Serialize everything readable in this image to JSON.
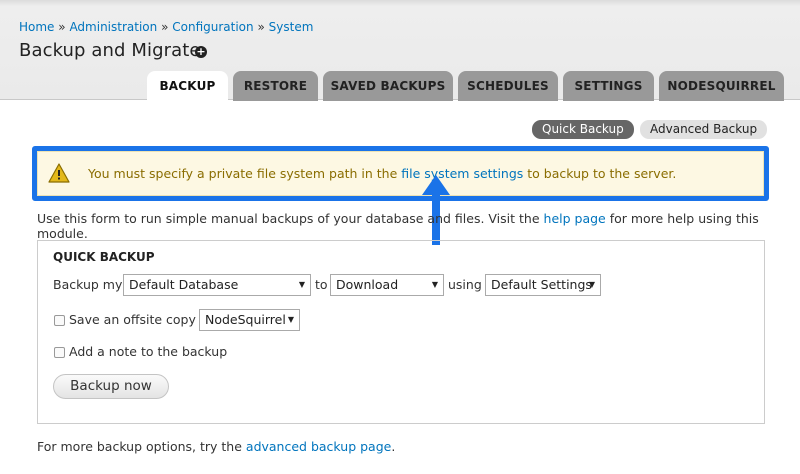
{
  "breadcrumb": {
    "items": [
      "Home",
      "Administration",
      "Configuration",
      "System"
    ],
    "separator": "»"
  },
  "page_title": "Backup and Migrate",
  "tabs": [
    {
      "label": "BACKUP",
      "active": true
    },
    {
      "label": "RESTORE",
      "active": false
    },
    {
      "label": "SAVED BACKUPS",
      "active": false
    },
    {
      "label": "SCHEDULES",
      "active": false
    },
    {
      "label": "SETTINGS",
      "active": false
    },
    {
      "label": "NODESQUIRREL",
      "active": false
    }
  ],
  "secondary_actions": {
    "quick_backup": "Quick Backup",
    "advanced_backup": "Advanced Backup"
  },
  "warning": {
    "icon": "warning-icon",
    "text_before": "You must specify a private file system path in the ",
    "link": "file system settings",
    "text_after": " to backup to the server."
  },
  "intro": {
    "text_before": "Use this form to run simple manual backups of your database and files. Visit the ",
    "link": "help page",
    "text_after": " for more help using this module."
  },
  "quick_backup": {
    "legend": "QUICK BACKUP",
    "backup_my_label": "Backup my",
    "source_value": "Default Database",
    "to_label": "to",
    "destination_value": "Download",
    "using_label": "using",
    "profile_value": "Default Settings",
    "offsite_label": "Save an offsite copy to",
    "offsite_value": "NodeSquirrel",
    "offsite_checked": false,
    "note_label": "Add a note to the backup",
    "note_checked": false,
    "submit_label": "Backup now"
  },
  "footer": {
    "text_before": "For more backup options, try the ",
    "link": "advanced backup page",
    "text_after": "."
  },
  "colors": {
    "link": "#0074bd",
    "highlight_border": "#1a73e8",
    "warning_bg": "#fdf8e3",
    "warning_text": "#8a6d00",
    "tab_inactive": "#999999"
  }
}
